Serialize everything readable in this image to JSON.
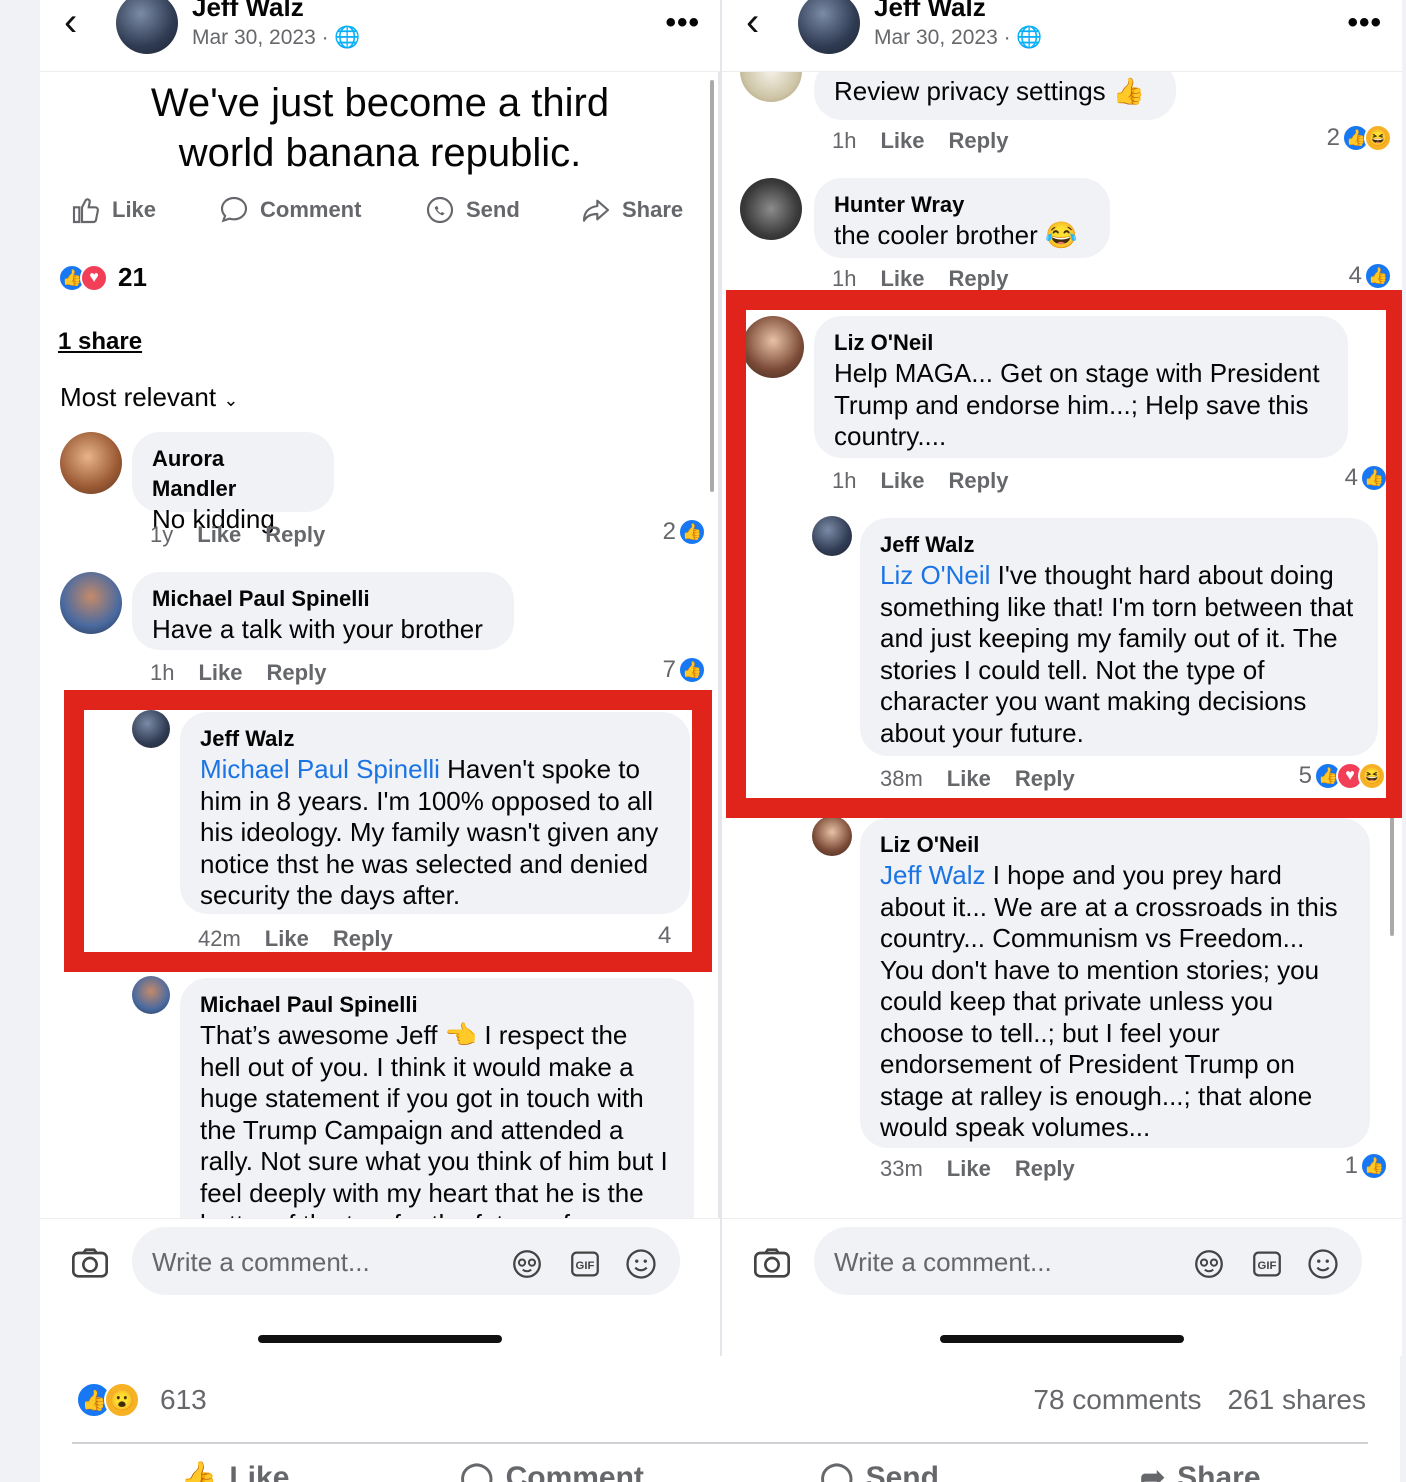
{
  "left": {
    "author": "Jeff Walz",
    "date": "Mar 30, 2023 · ",
    "post_text": "We've just become a third world banana republic.",
    "actions": {
      "like": "Like",
      "comment": "Comment",
      "send": "Send",
      "share": "Share"
    },
    "reaction_count": "21",
    "share_link": "1 share",
    "sort_label": "Most relevant",
    "comments": [
      {
        "name": "Aurora Mandler",
        "text": "No kidding",
        "time": "1y",
        "like": "Like",
        "reply": "Reply",
        "count": "2"
      },
      {
        "name": "Michael Paul Spinelli",
        "text": "Have a talk with your brother",
        "time": "1h",
        "like": "Like",
        "reply": "Reply",
        "count": "7"
      },
      {
        "name": "Jeff Walz",
        "mention": "Michael Paul Spinelli",
        "text": " Haven't spoke to him in 8 years.  I'm 100% opposed to all his ideology.  My family wasn't given any notice thst he was selected and denied security the days after.",
        "time": "42m",
        "like": "Like",
        "reply": "Reply",
        "count": "4"
      },
      {
        "name": "Michael Paul Spinelli",
        "text_a": "That’s awesome Jeff ",
        "emoji": "👈",
        "text_b": " I respect the hell out of you. I think it would make a huge statement if you got in touch with the Trump Campaign and attended a rally. Not sure what you think of him but I feel deeply with my heart that he is the better of the two for the future of our"
      }
    ],
    "composer_placeholder": "Write a comment..."
  },
  "right": {
    "author": "Jeff Walz",
    "date": "Mar 30, 2023 · ",
    "comments": [
      {
        "text": "Review privacy settings ",
        "emoji": "👍",
        "time": "1h",
        "like": "Like",
        "reply": "Reply",
        "count": "2"
      },
      {
        "name": "Hunter Wray",
        "text": "the cooler brother ",
        "emoji": "😂",
        "time": "1h",
        "like": "Like",
        "reply": "Reply",
        "count": "4"
      },
      {
        "name": "Liz O'Neil",
        "text": "Help MAGA... Get on stage with President Trump and endorse him...; Help save this country....",
        "time": "1h",
        "like": "Like",
        "reply": "Reply",
        "count": "4"
      },
      {
        "name": "Jeff Walz",
        "mention": "Liz O'Neil",
        "text": " I've thought hard about doing something like that! I'm torn between that and just keeping my family out of it. The stories I could tell. Not the type of character you want making decisions about your future.",
        "time": "38m",
        "like": "Like",
        "reply": "Reply",
        "count": "5"
      },
      {
        "name": "Liz O'Neil",
        "mention": "Jeff Walz",
        "text": " I hope and you prey hard about it... We are at a crossroads in this country... Communism vs Freedom... You don't have to mention stories; you could keep that private unless you choose to tell..; but I feel your endorsement of President Trump on stage at ralley is enough...; that alone would speak volumes...",
        "time": "33m",
        "like": "Like",
        "reply": "Reply",
        "count": "1"
      }
    ],
    "composer_placeholder": "Write a comment..."
  },
  "footer": {
    "reaction_count": "613",
    "comments": "78 comments",
    "shares": "261 shares",
    "buttons": {
      "like": "Like",
      "comment": "Comment",
      "send": "Send",
      "share": "Share"
    }
  },
  "icons": [
    "back-arrow-icon",
    "more-icon",
    "globe-icon",
    "like-icon",
    "comment-icon",
    "send-icon",
    "share-icon",
    "camera-icon",
    "sticker-icon",
    "gif-icon",
    "emoji-icon",
    "like-reaction-icon",
    "love-reaction-icon",
    "haha-reaction-icon",
    "wow-reaction-icon"
  ],
  "colors": {
    "accent": "#1877f2",
    "mention": "#1b74e4",
    "highlight_box": "#e0241b",
    "bubble": "#f0f2f5"
  }
}
